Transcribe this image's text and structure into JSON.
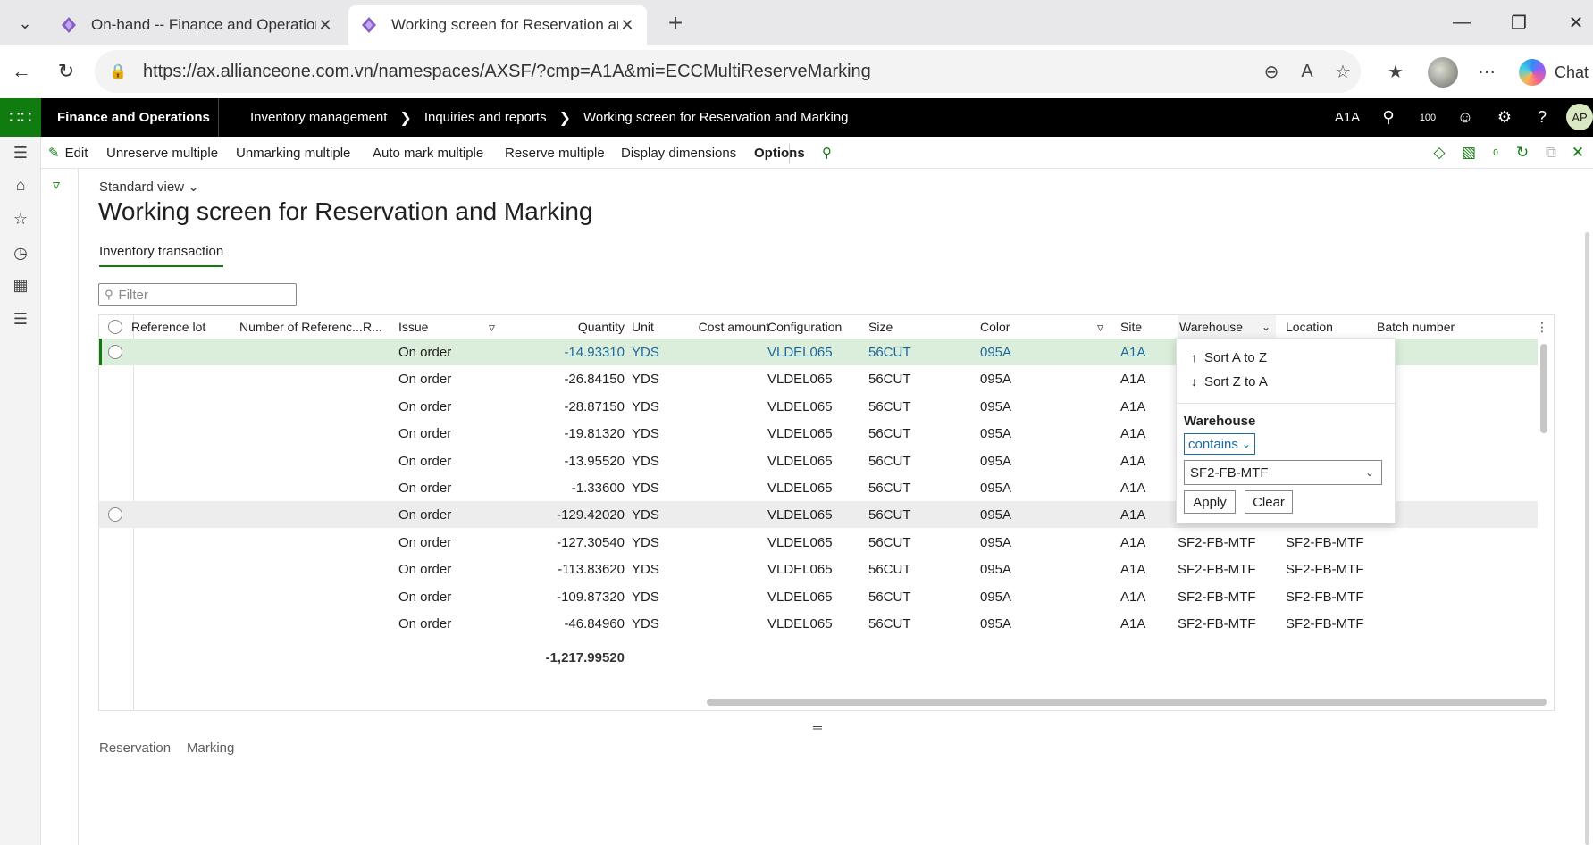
{
  "browser": {
    "tabs": [
      {
        "title": "On-hand -- Finance and Operation",
        "active": false
      },
      {
        "title": "Working screen for Reservation an",
        "active": true
      }
    ],
    "url": "https://ax.allianceone.com.vn/namespaces/AXSF/?cmp=A1A&mi=ECCMultiReserveMarking",
    "chat_label": "Chat"
  },
  "app": {
    "name": "Finance and Operations",
    "breadcrumbs": [
      "Inventory management",
      "Inquiries and reports",
      "Working screen for Reservation and Marking"
    ],
    "company": "A1A",
    "notifications": "100",
    "user_initials": "AP"
  },
  "actions": {
    "edit": "Edit",
    "unreserve": "Unreserve multiple",
    "unmarking": "Unmarking multiple",
    "automark": "Auto mark multiple",
    "reserve": "Reserve multiple",
    "display_dimensions": "Display dimensions",
    "options": "Options",
    "badge_count": "0"
  },
  "page": {
    "view": "Standard view",
    "title": "Working screen for Reservation and Marking",
    "tab": "Inventory transaction",
    "filter_placeholder": "Filter"
  },
  "grid": {
    "columns": [
      "Reference lot",
      "Number of Referenc...",
      "R...",
      "Issue",
      "Quantity",
      "Unit",
      "Cost amount",
      "Configuration",
      "Size",
      "Color",
      "Site",
      "Warehouse",
      "Location",
      "Batch number"
    ],
    "rows": [
      {
        "issue": "On order",
        "qty": "-14.93310",
        "unit": "YDS",
        "config": "VLDEL065",
        "size": "56CUT",
        "color": "095A",
        "site": "A1A",
        "warehouse": "",
        "location": ""
      },
      {
        "issue": "On order",
        "qty": "-26.84150",
        "unit": "YDS",
        "config": "VLDEL065",
        "size": "56CUT",
        "color": "095A",
        "site": "A1A",
        "warehouse": "",
        "location": ""
      },
      {
        "issue": "On order",
        "qty": "-28.87150",
        "unit": "YDS",
        "config": "VLDEL065",
        "size": "56CUT",
        "color": "095A",
        "site": "A1A",
        "warehouse": "",
        "location": ""
      },
      {
        "issue": "On order",
        "qty": "-19.81320",
        "unit": "YDS",
        "config": "VLDEL065",
        "size": "56CUT",
        "color": "095A",
        "site": "A1A",
        "warehouse": "",
        "location": ""
      },
      {
        "issue": "On order",
        "qty": "-13.95520",
        "unit": "YDS",
        "config": "VLDEL065",
        "size": "56CUT",
        "color": "095A",
        "site": "A1A",
        "warehouse": "",
        "location": ""
      },
      {
        "issue": "On order",
        "qty": "-1.33600",
        "unit": "YDS",
        "config": "VLDEL065",
        "size": "56CUT",
        "color": "095A",
        "site": "A1A",
        "warehouse": "",
        "location": ""
      },
      {
        "issue": "On order",
        "qty": "-129.42020",
        "unit": "YDS",
        "config": "VLDEL065",
        "size": "56CUT",
        "color": "095A",
        "site": "A1A",
        "warehouse": "",
        "location": ""
      },
      {
        "issue": "On order",
        "qty": "-127.30540",
        "unit": "YDS",
        "config": "VLDEL065",
        "size": "56CUT",
        "color": "095A",
        "site": "A1A",
        "warehouse": "SF2-FB-MTF",
        "location": "SF2-FB-MTF"
      },
      {
        "issue": "On order",
        "qty": "-113.83620",
        "unit": "YDS",
        "config": "VLDEL065",
        "size": "56CUT",
        "color": "095A",
        "site": "A1A",
        "warehouse": "SF2-FB-MTF",
        "location": "SF2-FB-MTF"
      },
      {
        "issue": "On order",
        "qty": "-109.87320",
        "unit": "YDS",
        "config": "VLDEL065",
        "size": "56CUT",
        "color": "095A",
        "site": "A1A",
        "warehouse": "SF2-FB-MTF",
        "location": "SF2-FB-MTF"
      },
      {
        "issue": "On order",
        "qty": "-46.84960",
        "unit": "YDS",
        "config": "VLDEL065",
        "size": "56CUT",
        "color": "095A",
        "site": "A1A",
        "warehouse": "SF2-FB-MTF",
        "location": "SF2-FB-MTF"
      }
    ],
    "total_quantity": "-1,217.99520"
  },
  "column_filter": {
    "sort_asc": "Sort A to Z",
    "sort_desc": "Sort Z to A",
    "field_label": "Warehouse",
    "operator": "contains",
    "value": "SF2-FB-MTF",
    "apply": "Apply",
    "clear": "Clear"
  },
  "bottom_tabs": [
    "Reservation",
    "Marking"
  ],
  "colors": {
    "brand_green": "#107c10",
    "link_blue": "#1c6a9e",
    "selected_row": "#dbeedb"
  }
}
